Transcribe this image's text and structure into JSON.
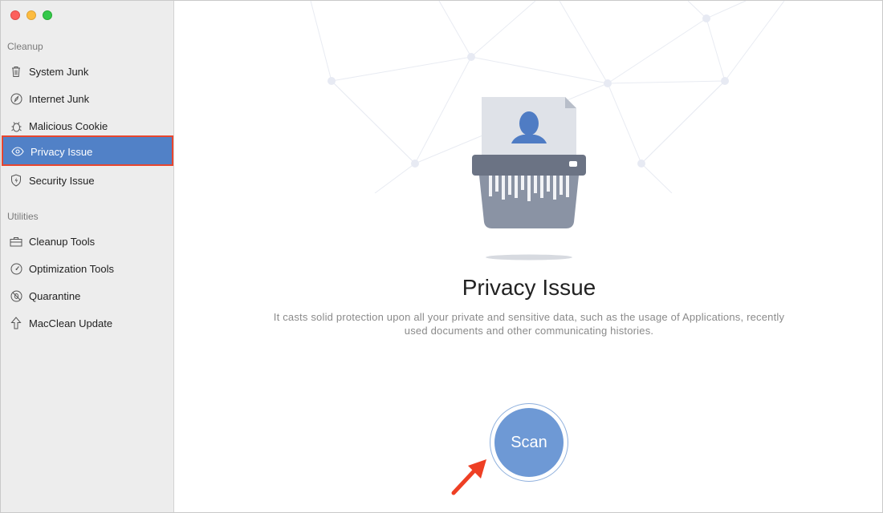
{
  "sidebar": {
    "sections": [
      {
        "label": "Cleanup"
      },
      {
        "label": "Utilities"
      }
    ],
    "items": [
      {
        "label": "System Junk",
        "icon": "trash-icon"
      },
      {
        "label": "Internet Junk",
        "icon": "compass-icon"
      },
      {
        "label": "Malicious Cookie",
        "icon": "bug-icon"
      },
      {
        "label": "Privacy Issue",
        "icon": "eye-icon",
        "active": true
      },
      {
        "label": "Security Issue",
        "icon": "shield-icon"
      },
      {
        "label": "Cleanup Tools",
        "icon": "toolbox-icon"
      },
      {
        "label": "Optimization Tools",
        "icon": "gauge-icon"
      },
      {
        "label": "Quarantine",
        "icon": "quarantine-icon"
      },
      {
        "label": "MacClean Update",
        "icon": "arrow-up-icon"
      }
    ]
  },
  "main": {
    "title": "Privacy Issue",
    "description": "It casts solid protection upon all your private and sensitive data, such as the usage of Applications, recently used documents and other communicating histories.",
    "scan_label": "Scan"
  },
  "colors": {
    "accent": "#5181c7",
    "highlight": "#e8462f",
    "scan": "#6e99d5"
  }
}
